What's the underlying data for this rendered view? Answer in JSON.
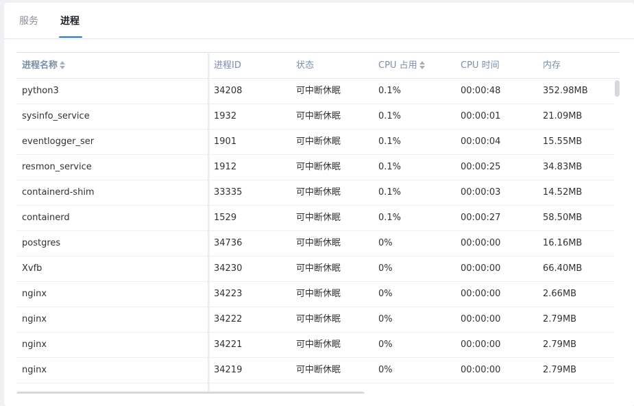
{
  "tabs": [
    {
      "label": "服务",
      "active": false
    },
    {
      "label": "进程",
      "active": true
    }
  ],
  "table": {
    "columns": [
      {
        "label": "进程名称",
        "sortable": true
      },
      {
        "label": "进程ID",
        "sortable": false
      },
      {
        "label": "状态",
        "sortable": false
      },
      {
        "label": "CPU 占用",
        "sortable": true
      },
      {
        "label": "CPU 时间",
        "sortable": false
      },
      {
        "label": "内存",
        "sortable": false
      }
    ],
    "rows": [
      [
        "python3",
        "34208",
        "可中断休眠",
        "0.1%",
        "00:00:48",
        "352.98MB"
      ],
      [
        "sysinfo_service",
        "1932",
        "可中断休眠",
        "0.1%",
        "00:00:01",
        "21.09MB"
      ],
      [
        "eventlogger_ser",
        "1901",
        "可中断休眠",
        "0.1%",
        "00:00:04",
        "15.55MB"
      ],
      [
        "resmon_service",
        "1912",
        "可中断休眠",
        "0.1%",
        "00:00:25",
        "34.83MB"
      ],
      [
        "containerd-shim",
        "33335",
        "可中断休眠",
        "0.1%",
        "00:00:03",
        "14.52MB"
      ],
      [
        "containerd",
        "1529",
        "可中断休眠",
        "0.1%",
        "00:00:27",
        "58.50MB"
      ],
      [
        "postgres",
        "34736",
        "可中断休眠",
        "0%",
        "00:00:00",
        "16.16MB"
      ],
      [
        "Xvfb",
        "34230",
        "可中断休眠",
        "0%",
        "00:00:00",
        "66.40MB"
      ],
      [
        "nginx",
        "34223",
        "可中断休眠",
        "0%",
        "00:00:00",
        "2.66MB"
      ],
      [
        "nginx",
        "34222",
        "可中断休眠",
        "0%",
        "00:00:00",
        "2.79MB"
      ],
      [
        "nginx",
        "34221",
        "可中断休眠",
        "0%",
        "00:00:00",
        "2.79MB"
      ],
      [
        "nginx",
        "34219",
        "可中断休眠",
        "0%",
        "00:00:00",
        "2.79MB"
      ]
    ]
  },
  "colors": {
    "accent": "#1a73e8",
    "header_text": "#7a8ea8",
    "cell_text": "#303133"
  }
}
